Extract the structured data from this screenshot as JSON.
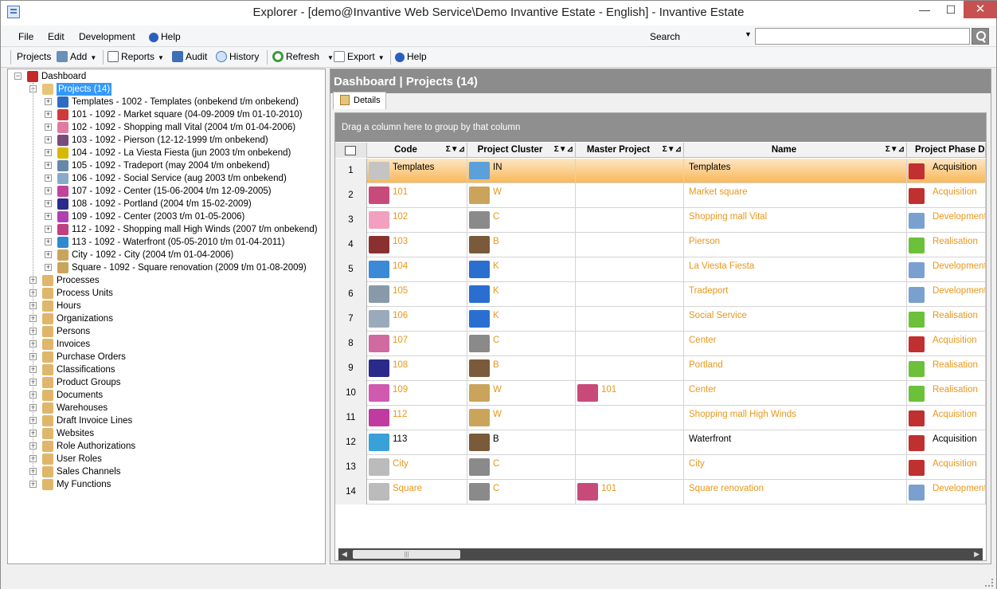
{
  "window": {
    "title": "Explorer - [demo@Invantive Web Service\\Demo Invantive Estate - English] - Invantive Estate",
    "min": "—",
    "max": "☐",
    "close": "✕"
  },
  "menu": {
    "items": [
      "File",
      "Edit",
      "Development",
      "Help"
    ],
    "search_label": "Search",
    "search_value": ""
  },
  "toolbar": {
    "projects": "Projects",
    "add": "Add",
    "reports": "Reports",
    "audit": "Audit",
    "history": "History",
    "refresh": "Refresh",
    "export": "Export",
    "help": "Help"
  },
  "tree": {
    "root": "Dashboard",
    "projects": "Projects (14)",
    "project_items": [
      "Templates - 1002 - Templates (onbekend t/m onbekend)",
      "101 - 1092 - Market square (04-09-2009 t/m 01-10-2010)",
      "102 - 1092 - Shopping mall Vital (2004 t/m 01-04-2006)",
      "103 - 1092 - Pierson (12-12-1999 t/m onbekend)",
      "104 - 1092 - La Viesta Fiesta (jun 2003 t/m onbekend)",
      "105 - 1092 - Tradeport (may 2004 t/m onbekend)",
      "106 - 1092 - Social Service (aug 2003 t/m onbekend)",
      "107 - 1092 - Center (15-06-2004 t/m 12-09-2005)",
      "108 - 1092 - Portland (2004 t/m 15-02-2009)",
      "109 - 1092 - Center (2003 t/m 01-05-2006)",
      "112 - 1092 - Shopping mall High Winds (2007 t/m onbekend)",
      "113 - 1092 - Waterfront (05-05-2010 t/m 01-04-2011)",
      "City - 1092 - City (2004 t/m 01-04-2006)",
      "Square - 1092 - Square renovation (2009 t/m 01-08-2009)"
    ],
    "categories": [
      "Processes",
      "Process Units",
      "Hours",
      "Organizations",
      "Persons",
      "Invoices",
      "Purchase Orders",
      "Classifications",
      "Product Groups",
      "Documents",
      "Warehouses",
      "Draft Invoice Lines",
      "Websites",
      "Role Authorizations",
      "User Roles",
      "Sales Channels",
      "My Functions"
    ]
  },
  "right": {
    "header": "Dashboard | Projects (14)",
    "tab": "Details",
    "group_hint": "Drag a column here to group by that column"
  },
  "grid": {
    "columns": [
      "Code",
      "Project Cluster",
      "Master Project",
      "Name",
      "Project Phase D"
    ],
    "filter_icons": "Σ▼⊿",
    "rows": [
      {
        "n": "1",
        "code": "Templates",
        "cluster": "IN",
        "master": "",
        "name": "Templates",
        "phase": "Acquisition"
      },
      {
        "n": "2",
        "code": "101",
        "cluster": "W",
        "master": "",
        "name": "Market square",
        "phase": "Acquisition"
      },
      {
        "n": "3",
        "code": "102",
        "cluster": "C",
        "master": "",
        "name": "Shopping mall Vital",
        "phase": "Development"
      },
      {
        "n": "4",
        "code": "103",
        "cluster": "B",
        "master": "",
        "name": "Pierson",
        "phase": "Realisation"
      },
      {
        "n": "5",
        "code": "104",
        "cluster": "K",
        "master": "",
        "name": "La Viesta Fiesta",
        "phase": "Development"
      },
      {
        "n": "6",
        "code": "105",
        "cluster": "K",
        "master": "",
        "name": "Tradeport",
        "phase": "Development"
      },
      {
        "n": "7",
        "code": "106",
        "cluster": "K",
        "master": "",
        "name": "Social Service",
        "phase": "Realisation"
      },
      {
        "n": "8",
        "code": "107",
        "cluster": "C",
        "master": "",
        "name": "Center",
        "phase": "Acquisition"
      },
      {
        "n": "9",
        "code": "108",
        "cluster": "B",
        "master": "",
        "name": "Portland",
        "phase": "Realisation"
      },
      {
        "n": "10",
        "code": "109",
        "cluster": "W",
        "master": "101",
        "name": "Center",
        "phase": "Realisation"
      },
      {
        "n": "11",
        "code": "112",
        "cluster": "W",
        "master": "",
        "name": "Shopping mall High Winds",
        "phase": "Acquisition"
      },
      {
        "n": "12",
        "code": "113",
        "cluster": "B",
        "master": "",
        "name": "Waterfront",
        "phase": "Acquisition"
      },
      {
        "n": "13",
        "code": "City",
        "cluster": "C",
        "master": "",
        "name": "City",
        "phase": "Acquisition"
      },
      {
        "n": "14",
        "code": "Square",
        "cluster": "C",
        "master": "101",
        "name": "Square renovation",
        "phase": "Development"
      }
    ]
  },
  "scroll": {
    "left": "◀",
    "right": "▶",
    "thumb": "|||"
  },
  "colors": {
    "accent_link": "#e8971b",
    "selected_row": "#f9b85a",
    "tree_selection": "#3399ff",
    "header_gray": "#8c8c8c"
  }
}
